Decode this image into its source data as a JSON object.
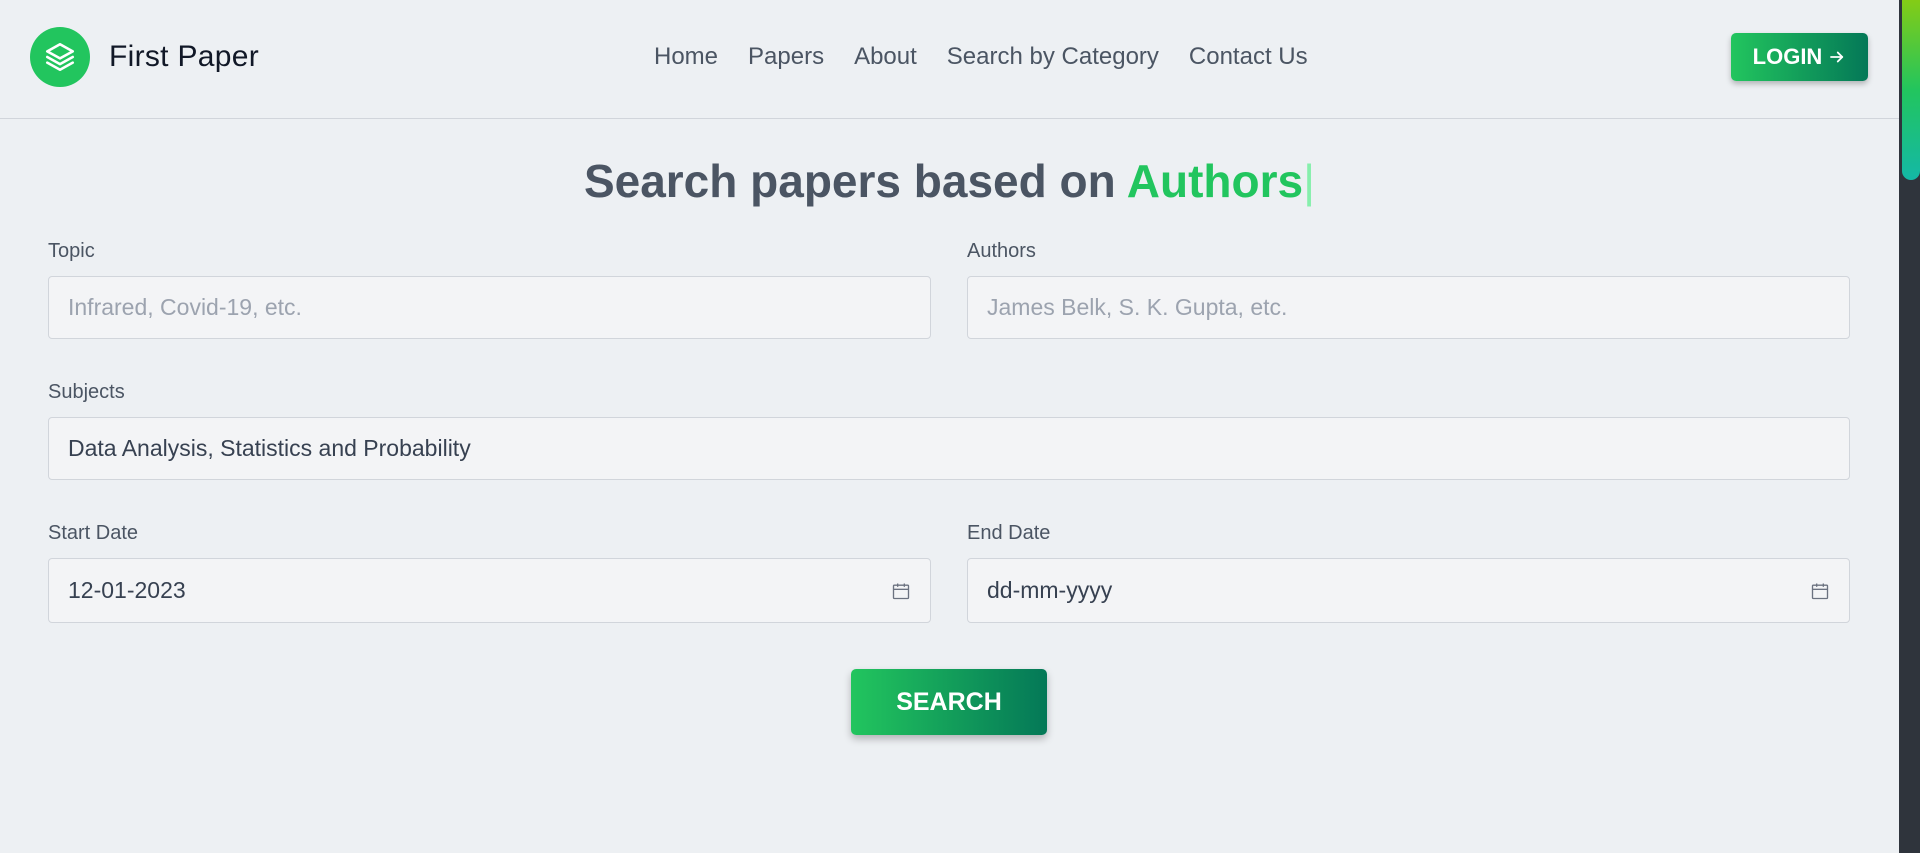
{
  "header": {
    "brand_name": "First Paper",
    "logo_icon": "layers-icon",
    "nav": [
      "Home",
      "Papers",
      "About",
      "Search by Category",
      "Contact Us"
    ],
    "login_label": "LOGIN",
    "login_icon": "arrow-right-icon"
  },
  "hero": {
    "prefix": "Search papers based on ",
    "highlight": "Authors",
    "caret": "|"
  },
  "form": {
    "topic": {
      "label": "Topic",
      "value": "",
      "placeholder": "Infrared, Covid-19, etc."
    },
    "authors": {
      "label": "Authors",
      "value": "",
      "placeholder": "James Belk, S. K. Gupta, etc."
    },
    "subjects": {
      "label": "Subjects",
      "value": "Data Analysis, Statistics and Probability"
    },
    "start_date": {
      "label": "Start Date",
      "value": "12-01-2023"
    },
    "end_date": {
      "label": "End Date",
      "value": "dd-mm-yyyy"
    },
    "search_label": "SEARCH"
  },
  "colors": {
    "accent": "#22c55e",
    "accent_dark": "#047857",
    "background": "#edf0f3"
  }
}
